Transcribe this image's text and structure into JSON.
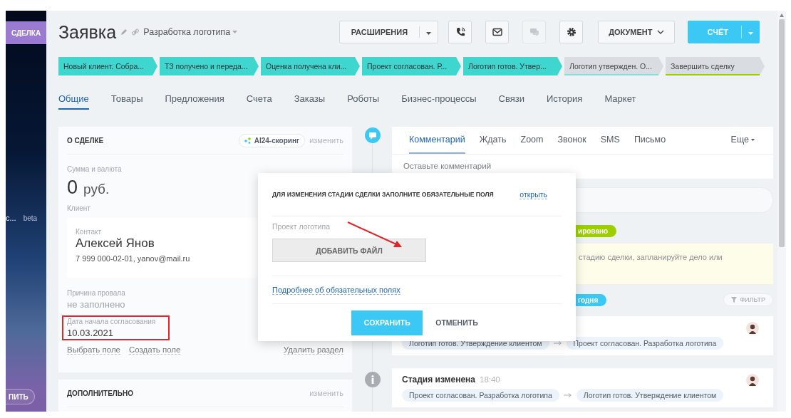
{
  "sidebar": {
    "section_tab": "СДЕЛКА",
    "item_text": "c...",
    "item_badge": "beta",
    "bottom_button": "ПИТЬ"
  },
  "header": {
    "title": "Заявка",
    "category": "Разработка логотипа",
    "extensions_button": "РАСШИРЕНИЯ",
    "icon_buttons": [
      {
        "disabled": false
      },
      {
        "disabled": false
      },
      {
        "disabled": true
      },
      {
        "disabled": false
      }
    ],
    "document_button": "ДОКУМЕНТ",
    "invoice_button": "СЧЁТ"
  },
  "stages": [
    {
      "label": "Новый клиент. Собра...",
      "done": true,
      "color": "#3fd6cf"
    },
    {
      "label": "ТЗ получено и переда...",
      "done": true,
      "color": "#3fd6cf"
    },
    {
      "label": "Оценка получена кли...",
      "done": true,
      "color": "#3fd6cf"
    },
    {
      "label": "Проект согласован. Р...",
      "done": true,
      "color": "#3fd6cf"
    },
    {
      "label": "Логотип готов. Утвер...",
      "done": true,
      "color": "#3fd6cf"
    },
    {
      "label": "Логотип утвержден. О...",
      "done": false,
      "color": "#8fdbdc"
    },
    {
      "label": "Завершить сделку",
      "done": false,
      "color": "#9dcf00"
    }
  ],
  "tabs": [
    {
      "label": "Общие",
      "selected": true
    },
    {
      "label": "Товары",
      "selected": false
    },
    {
      "label": "Предложения",
      "selected": false
    },
    {
      "label": "Счета",
      "selected": false
    },
    {
      "label": "Заказы",
      "selected": false
    },
    {
      "label": "Роботы",
      "selected": false
    },
    {
      "label": "Бизнес-процессы",
      "selected": false
    },
    {
      "label": "Связи",
      "selected": false
    },
    {
      "label": "История",
      "selected": false
    },
    {
      "label": "Маркет",
      "selected": false
    }
  ],
  "deal_card": {
    "title": "О СДЕЛКЕ",
    "scoring": "AI24-скоринг",
    "edit": "изменить",
    "amount_label": "Сумма и валюта",
    "amount": "0",
    "currency": "руб.",
    "client_label": "Клиент",
    "contact": {
      "label": "Контакт",
      "name": "Алексей Янов",
      "details": "7 999 000-02-01, yanov@mail.ru"
    },
    "fields": [
      {
        "label": "Причина провала",
        "value": "не заполнено",
        "empty": true,
        "highlighted": false
      },
      {
        "label": "Дата начала согласования",
        "value": "10.03.2021",
        "empty": false,
        "highlighted": true
      }
    ],
    "links": [
      "Выбрать поле",
      "Создать поле"
    ],
    "delete_link": "Удалить раздел"
  },
  "extra_card": {
    "title": "ДОПОЛНИТЕЛЬНО",
    "edit": "изменить"
  },
  "activity": {
    "tabs": [
      {
        "label": "Комментарий",
        "selected": true
      },
      {
        "label": "Ждать",
        "selected": false
      },
      {
        "label": "Zoom",
        "selected": false
      },
      {
        "label": "Звонок",
        "selected": false
      },
      {
        "label": "SMS",
        "selected": false
      },
      {
        "label": "Письмо",
        "selected": false
      }
    ],
    "more": "Еще",
    "comment_placeholder": "Оставьте комментарий"
  },
  "timeline": {
    "planned_badge": "ировано",
    "note": "стадию сделки, запланируйте дело или",
    "day_badge": "годня",
    "filter": "ФИЛЬТР",
    "events": [
      {
        "from": "Логотип готов. Утверждение клиентом",
        "to": "Проект согласован. Разработка логотипа"
      },
      {
        "title": "Стадия изменена",
        "time": "18:40",
        "from": "Проект согласован. Разработка логотипа",
        "to": "Логотип готов. Утверждение клиентом"
      }
    ]
  },
  "popup": {
    "title": "ДЛЯ ИЗМЕНЕНИЯ СТАДИИ СДЕЛКИ ЗАПОЛНИТЕ ОБЯЗАТЕЛЬНЫЕ ПОЛЯ",
    "open_link": "открыть",
    "field_label": "Проект логотипа",
    "add_file": "ДОБАВИТЬ ФАЙЛ",
    "more_link": "Подробнее об обязательных полях",
    "save": "СОХРАНИТЬ",
    "cancel": "ОТМЕНИТЬ"
  }
}
